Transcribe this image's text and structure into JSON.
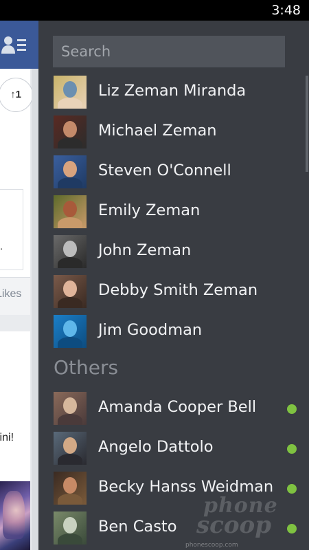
{
  "status_bar": {
    "time": "3:48"
  },
  "feed": {
    "badge": "↑1",
    "snippet_period": ".",
    "likes_label": "Likes",
    "snippet_text": "lini!"
  },
  "chat": {
    "search": {
      "placeholder": "Search",
      "value": ""
    },
    "contacts": [
      {
        "name": "Liz Zeman Miranda",
        "online": false,
        "avatar_colors": [
          "#c9b46a",
          "#6b8fb0",
          "#e9d2b8"
        ]
      },
      {
        "name": "Michael Zeman",
        "online": false,
        "avatar_colors": [
          "#5a2a22",
          "#c48a6a",
          "#2c2c2c"
        ]
      },
      {
        "name": "Steven O'Connell",
        "online": false,
        "avatar_colors": [
          "#3a5f9e",
          "#d8a37e",
          "#1f3a63"
        ]
      },
      {
        "name": "Emily Zeman",
        "online": false,
        "avatar_colors": [
          "#5d6a2a",
          "#a85a3a",
          "#c99a6a"
        ]
      },
      {
        "name": "John Zeman",
        "online": false,
        "avatar_colors": [
          "#6a6a6a",
          "#bcbcbc",
          "#2a2a2a"
        ]
      },
      {
        "name": "Debby Smith Zeman",
        "online": false,
        "avatar_colors": [
          "#7a5a4a",
          "#e0b49a",
          "#3a2a22"
        ]
      },
      {
        "name": "Jim Goodman",
        "online": false,
        "avatar_colors": [
          "#1b7fc8",
          "#5fb7ea",
          "#0d4c80"
        ]
      }
    ],
    "others_title": "Others",
    "others": [
      {
        "name": "Amanda Cooper Bell",
        "online": true,
        "avatar_colors": [
          "#8a6a5a",
          "#d6b79c",
          "#4a3a3a"
        ]
      },
      {
        "name": "Angelo Dattolo",
        "online": true,
        "avatar_colors": [
          "#5a6a7a",
          "#d2a986",
          "#2a2a30"
        ]
      },
      {
        "name": "Becky Hanss Weidman",
        "online": true,
        "avatar_colors": [
          "#3a2a22",
          "#c78a66",
          "#7a5a3a"
        ]
      },
      {
        "name": "Ben Casto",
        "online": true,
        "avatar_colors": [
          "#7a8a6a",
          "#c9d2c0",
          "#3a4a3a"
        ]
      }
    ],
    "online_color": "#7fc241"
  },
  "watermark": {
    "line1": "phone",
    "line2": "scoop",
    "url": "phonescoop.com"
  },
  "colors": {
    "facebook_blue": "#3b5998",
    "chat_bg": "#393c42"
  }
}
